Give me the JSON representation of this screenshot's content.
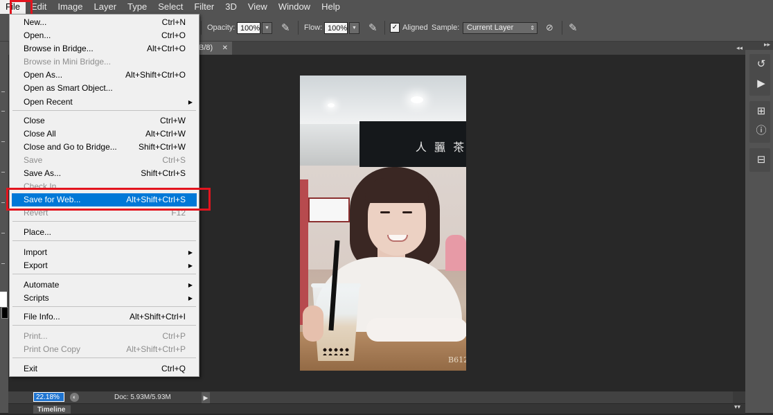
{
  "menubar": {
    "items": [
      "File",
      "Edit",
      "Image",
      "Layer",
      "Type",
      "Select",
      "Filter",
      "3D",
      "View",
      "Window",
      "Help"
    ]
  },
  "options": {
    "opacity_label": "Opacity:",
    "opacity_value": "100%",
    "flow_label": "Flow:",
    "flow_value": "100%",
    "aligned_label": "Aligned",
    "aligned_checked": true,
    "sample_label": "Sample:",
    "sample_value": "Current Layer"
  },
  "document": {
    "tab_label": "B/8)",
    "photo_watermark": "B612"
  },
  "status": {
    "zoom": "22.18%",
    "doc_size": "Doc: 5.93M/5.93M"
  },
  "timeline": {
    "tab_label": "Timeline"
  },
  "file_menu": {
    "items": [
      {
        "label": "New...",
        "shortcut": "Ctrl+N"
      },
      {
        "label": "Open...",
        "shortcut": "Ctrl+O"
      },
      {
        "label": "Browse in Bridge...",
        "shortcut": "Alt+Ctrl+O"
      },
      {
        "label": "Browse in Mini Bridge...",
        "shortcut": ""
      },
      {
        "label": "Open As...",
        "shortcut": "Alt+Shift+Ctrl+O"
      },
      {
        "label": "Open as Smart Object...",
        "shortcut": ""
      },
      {
        "label": "Open Recent",
        "shortcut": ""
      },
      {
        "label": "Close",
        "shortcut": "Ctrl+W"
      },
      {
        "label": "Close All",
        "shortcut": "Alt+Ctrl+W"
      },
      {
        "label": "Close and Go to Bridge...",
        "shortcut": "Shift+Ctrl+W"
      },
      {
        "label": "Save",
        "shortcut": "Ctrl+S"
      },
      {
        "label": "Save As...",
        "shortcut": "Shift+Ctrl+S"
      },
      {
        "label": "Check In...",
        "shortcut": ""
      },
      {
        "label": "Save for Web...",
        "shortcut": "Alt+Shift+Ctrl+S"
      },
      {
        "label": "Revert",
        "shortcut": "F12"
      },
      {
        "label": "Place...",
        "shortcut": ""
      },
      {
        "label": "Import",
        "shortcut": ""
      },
      {
        "label": "Export",
        "shortcut": ""
      },
      {
        "label": "Automate",
        "shortcut": ""
      },
      {
        "label": "Scripts",
        "shortcut": ""
      },
      {
        "label": "File Info...",
        "shortcut": "Alt+Shift+Ctrl+I"
      },
      {
        "label": "Print...",
        "shortcut": "Ctrl+P"
      },
      {
        "label": "Print One Copy",
        "shortcut": "Alt+Shift+Ctrl+P"
      },
      {
        "label": "Exit",
        "shortcut": "Ctrl+Q"
      }
    ]
  },
  "icons": {
    "submenu_arrow": "triangle-right-icon",
    "close_tab": "close-icon",
    "collapse": "double-chevron-icon"
  },
  "colors": {
    "selection_blue": "#0078d7",
    "highlight_red": "#e3141e"
  }
}
